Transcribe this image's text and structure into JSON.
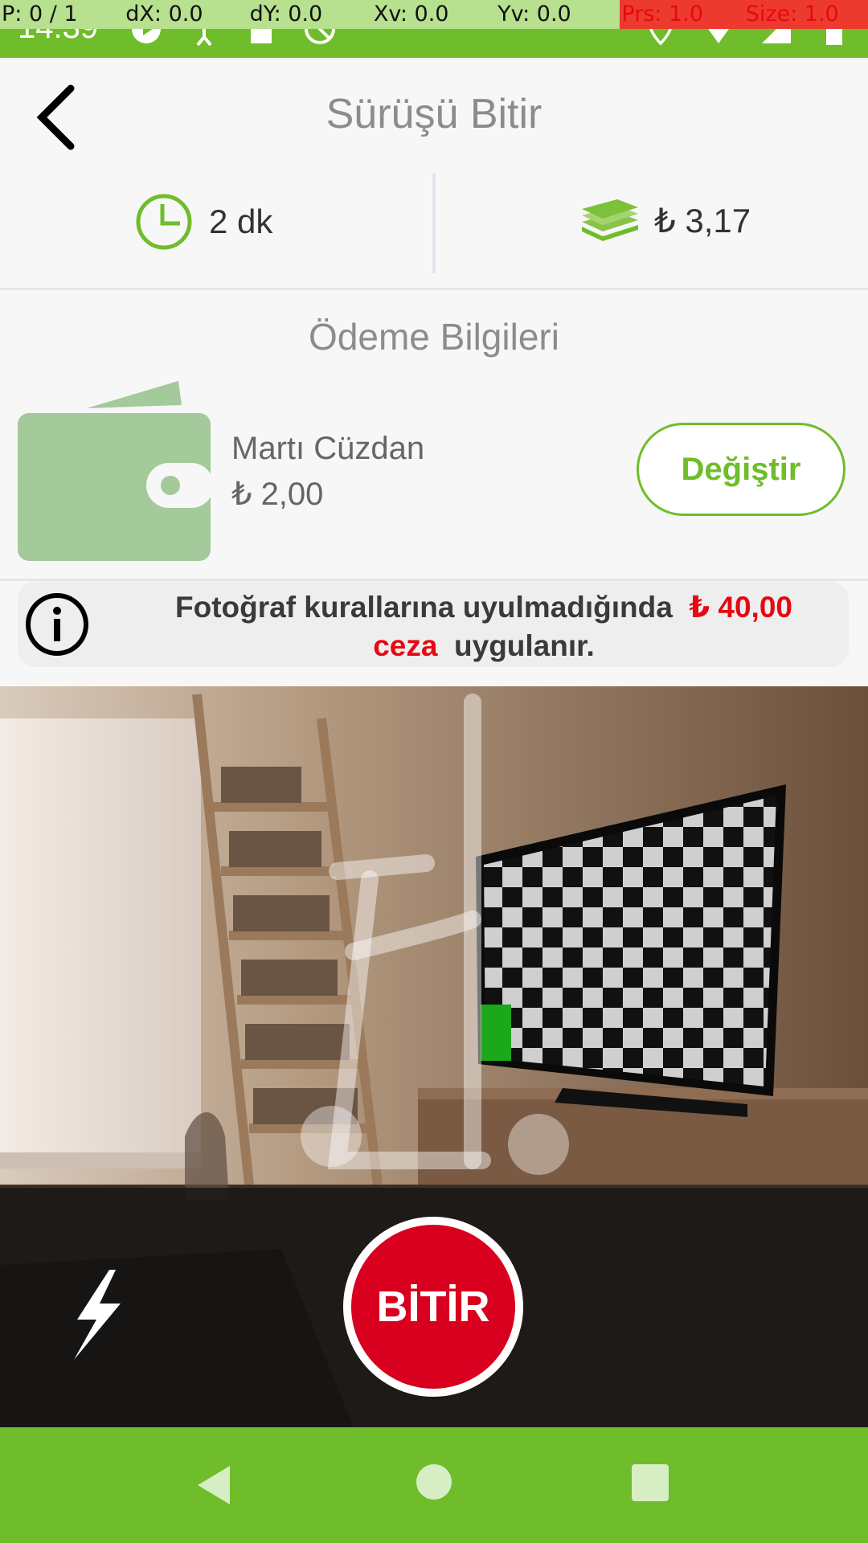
{
  "debug_bar": [
    "P: 0 / 1",
    "dX: 0.0",
    "dY: 0.0",
    "Xv: 0.0",
    "Yv: 0.0",
    "Prs: 1.0",
    "Size: 1.0"
  ],
  "status_bar": {
    "time": "14:39"
  },
  "header": {
    "title": "Sürüşü Bitir"
  },
  "stats": {
    "duration": "2 dk",
    "cost": "₺ 3,17"
  },
  "payment": {
    "section_title": "Ödeme Bilgileri",
    "wallet_name": "Martı Cüzdan",
    "wallet_balance": "₺ 2,00",
    "change_label": "Değiştir"
  },
  "warning": {
    "text_part1": "Fotoğraf kurallarına uyulmadığında",
    "fine": "₺ 40,00",
    "text_ceza": "ceza",
    "text_part2": "uygulanır."
  },
  "camera": {
    "finish_label": "BİTİR"
  },
  "colors": {
    "brand": "#6fbd2b",
    "finish": "#d8001e",
    "warning_red": "#e50914"
  }
}
